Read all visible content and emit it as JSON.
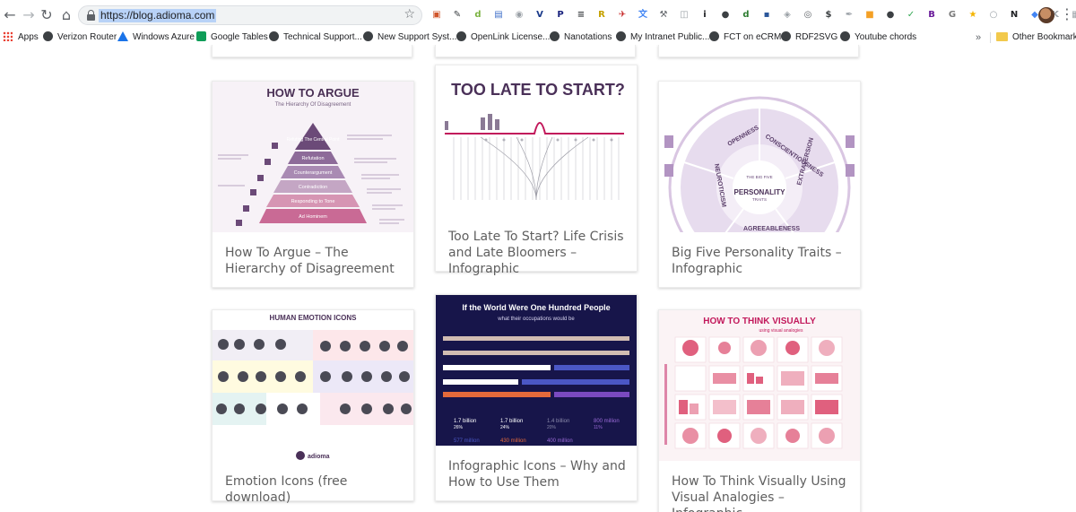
{
  "browser": {
    "url": "https://blog.adioma.com",
    "nav_icons": {
      "back": "←",
      "forward": "→",
      "reload": "↻",
      "home": "⌂",
      "star": "☆",
      "menu": "⋮"
    },
    "extensions": [
      {
        "name": "extension-box",
        "glyph": "▣",
        "color": "#d0552b"
      },
      {
        "name": "extension-edit",
        "glyph": "✎",
        "color": "#3c4043"
      },
      {
        "name": "extension-d",
        "glyph": "d",
        "color": "#7cb342"
      },
      {
        "name": "extension-slides",
        "glyph": "▤",
        "color": "#3f6fc9"
      },
      {
        "name": "extension-bulb",
        "glyph": "◉",
        "color": "#9aa0a6"
      },
      {
        "name": "extension-v",
        "glyph": "V",
        "color": "#1a3a8a"
      },
      {
        "name": "extension-p",
        "glyph": "P",
        "color": "#1a237e"
      },
      {
        "name": "extension-layers",
        "glyph": "≡",
        "color": "#3c4043"
      },
      {
        "name": "extension-r",
        "glyph": "R",
        "color": "#c5a100"
      },
      {
        "name": "extension-bird",
        "glyph": "✈",
        "color": "#c62828"
      },
      {
        "name": "extension-translate",
        "glyph": "文",
        "color": "#4285f4"
      },
      {
        "name": "extension-tool",
        "glyph": "⚒",
        "color": "#5f6368"
      },
      {
        "name": "extension-screenshot",
        "glyph": "◫",
        "color": "#9aa0a6"
      },
      {
        "name": "extension-info",
        "glyph": "i",
        "color": "#202124"
      },
      {
        "name": "extension-panda",
        "glyph": "●",
        "color": "#3c4043"
      },
      {
        "name": "extension-d2",
        "glyph": "d",
        "color": "#2e7d32"
      },
      {
        "name": "extension-save",
        "glyph": "▪",
        "color": "#2b579a"
      },
      {
        "name": "extension-shield",
        "glyph": "◈",
        "color": "#9aa0a6"
      },
      {
        "name": "extension-eye",
        "glyph": "◎",
        "color": "#5f6368"
      },
      {
        "name": "extension-dollar",
        "glyph": "$",
        "color": "#3c4043"
      },
      {
        "name": "extension-pen",
        "glyph": "✒",
        "color": "#9aa0a6"
      },
      {
        "name": "extension-orange",
        "glyph": "■",
        "color": "#f4a025"
      },
      {
        "name": "extension-circle",
        "glyph": "●",
        "color": "#3c4043"
      },
      {
        "name": "extension-check",
        "glyph": "✓",
        "color": "#34a853"
      },
      {
        "name": "extension-b",
        "glyph": "B",
        "color": "#6a1b9a"
      },
      {
        "name": "extension-g",
        "glyph": "G",
        "color": "#7b7b7b"
      },
      {
        "name": "extension-star",
        "glyph": "★",
        "color": "#f4b400"
      },
      {
        "name": "extension-ring",
        "glyph": "○",
        "color": "#9aa0a6"
      },
      {
        "name": "extension-n",
        "glyph": "N",
        "color": "#202124"
      },
      {
        "name": "extension-cube",
        "glyph": "◆",
        "color": "#4285f4"
      },
      {
        "name": "extension-k",
        "glyph": "K",
        "color": "#9aa0a6"
      },
      {
        "name": "extension-doc",
        "glyph": "▦",
        "color": "#9aa0a6"
      }
    ]
  },
  "bookmarks": {
    "items": [
      {
        "label": "Apps",
        "icon": "apps-grid-icon"
      },
      {
        "label": "Verizon Router",
        "icon": "globe-icon"
      },
      {
        "label": "Windows Azure",
        "icon": "azure-icon"
      },
      {
        "label": "Google Tables",
        "icon": "sheet-icon"
      },
      {
        "label": "Technical Support...",
        "icon": "globe-icon"
      },
      {
        "label": "New Support Syst...",
        "icon": "globe-icon"
      },
      {
        "label": "OpenLink License...",
        "icon": "globe-icon"
      },
      {
        "label": "Nanotations",
        "icon": "globe-icon"
      },
      {
        "label": "My Intranet Public...",
        "icon": "globe-icon"
      },
      {
        "label": "FCT on eCRM",
        "icon": "globe-icon"
      },
      {
        "label": "RDF2SVG",
        "icon": "globe-icon"
      },
      {
        "label": "Youtube chords",
        "icon": "globe-icon"
      }
    ],
    "overflow": "»",
    "other": "Other Bookmarks"
  },
  "posts": [
    {
      "title": "How To Argue – The Hierarchy of Disagreement",
      "thumb": {
        "heading": "HOW TO ARGUE",
        "subheading": "The Hierarchy Of Disagreement",
        "levels": [
          "Refuting The Central Point",
          "Refutation",
          "Counterargument",
          "Contradiction",
          "Responding to Tone",
          "Ad Hominem"
        ]
      }
    },
    {
      "title": "Too Late To Start? Life Crisis and Late Bloomers – Infographic",
      "thumb": {
        "heading": "TOO LATE TO START?"
      }
    },
    {
      "title": "Big Five Personality Traits – Infographic",
      "thumb": {
        "center_top": "THE BIG FIVE",
        "center_main": "PERSONALITY",
        "center_bottom": "TRAITS",
        "traits": [
          "OPENNESS",
          "CONSCIENTIOUSNESS",
          "EXTRAVERSION",
          "AGREEABLENESS",
          "NEUROTICISM"
        ]
      }
    },
    {
      "title": "Emotion Icons (free download)",
      "thumb": {
        "heading": "HUMAN EMOTION ICONS",
        "footer": "adioma"
      }
    },
    {
      "title": "Infographic Icons – Why and How to Use Them",
      "thumb": {
        "heading": "If the World Were One Hundred People",
        "subheading": "what their occupations would be",
        "stats": [
          {
            "value": "1.7 billion",
            "pct": "26%"
          },
          {
            "value": "1.7 billion",
            "pct": "24%"
          },
          {
            "value": "1.4 billion",
            "pct": "20%"
          },
          {
            "value": "800 million",
            "pct": "11%"
          }
        ],
        "bottom_stats": [
          "577 million",
          "430 million",
          "400 million"
        ]
      }
    },
    {
      "title": "How To Think Visually Using Visual Analogies – Infographic",
      "thumb": {
        "heading": "HOW TO THINK VISUALLY",
        "subheading": "using visual analogies"
      }
    }
  ]
}
